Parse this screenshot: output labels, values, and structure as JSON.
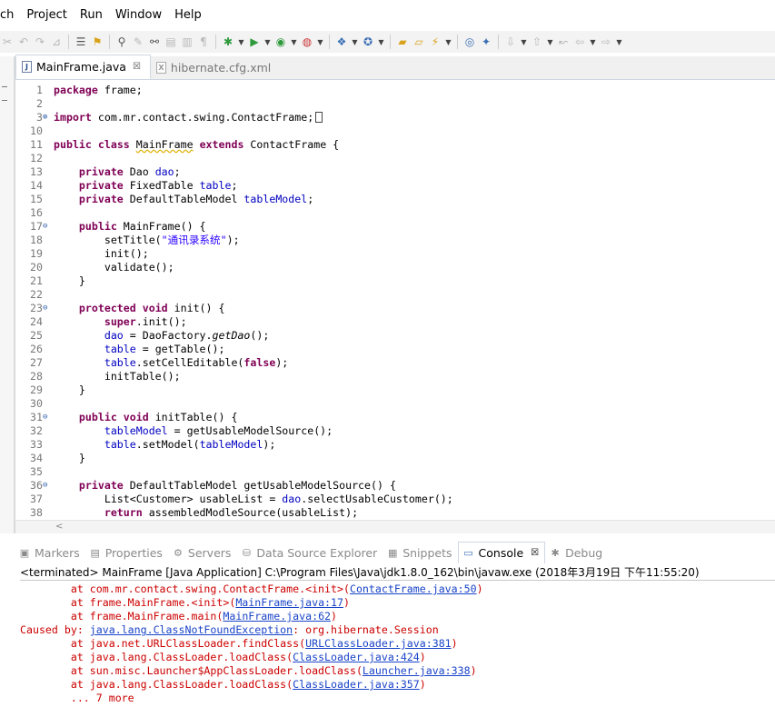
{
  "menu": [
    "ch",
    "Project",
    "Run",
    "Window",
    "Help"
  ],
  "editor": {
    "tabs": [
      {
        "label": "MainFrame.java",
        "active": true,
        "icon": "java-file-icon"
      },
      {
        "label": "hibernate.cfg.xml",
        "active": false,
        "icon": "xml-file-icon"
      }
    ],
    "close_glyph": "☒"
  },
  "code_lines": [
    {
      "n": "1",
      "parts": [
        [
          "kw",
          "package"
        ],
        [
          "t",
          " frame;"
        ]
      ]
    },
    {
      "n": "2",
      "parts": []
    },
    {
      "n": "3",
      "fold": "plus",
      "parts": [
        [
          "kw",
          "import"
        ],
        [
          "t",
          " com.mr.contact.swing.ContactFrame;"
        ]
      ],
      "box": true
    },
    {
      "n": "10",
      "parts": []
    },
    {
      "n": "11",
      "glyph": "warning",
      "parts": [
        [
          "kw",
          "public"
        ],
        [
          "t",
          " "
        ],
        [
          "kw",
          "class"
        ],
        [
          "t",
          " "
        ],
        [
          "u",
          "MainFrame"
        ],
        [
          "t",
          " "
        ],
        [
          "kw",
          "extends"
        ],
        [
          "t",
          " ContactFrame {"
        ]
      ]
    },
    {
      "n": "12",
      "parts": []
    },
    {
      "n": "13",
      "parts": [
        [
          "t",
          "    "
        ],
        [
          "kw",
          "private"
        ],
        [
          "t",
          " Dao "
        ],
        [
          "fd",
          "dao"
        ],
        [
          "t",
          ";"
        ]
      ]
    },
    {
      "n": "14",
      "parts": [
        [
          "t",
          "    "
        ],
        [
          "kw",
          "private"
        ],
        [
          "t",
          " FixedTable "
        ],
        [
          "fd",
          "table"
        ],
        [
          "t",
          ";"
        ]
      ]
    },
    {
      "n": "15",
      "parts": [
        [
          "t",
          "    "
        ],
        [
          "kw",
          "private"
        ],
        [
          "t",
          " DefaultTableModel "
        ],
        [
          "fd",
          "tableModel"
        ],
        [
          "t",
          ";"
        ]
      ]
    },
    {
      "n": "16",
      "parts": []
    },
    {
      "n": "17",
      "fold": "minus",
      "parts": [
        [
          "t",
          "    "
        ],
        [
          "kw",
          "public"
        ],
        [
          "t",
          " MainFrame() {"
        ]
      ]
    },
    {
      "n": "18",
      "parts": [
        [
          "t",
          "        setTitle("
        ],
        [
          "st",
          "\"通讯录系统\""
        ],
        [
          "t",
          ");"
        ]
      ]
    },
    {
      "n": "19",
      "parts": [
        [
          "t",
          "        init();"
        ]
      ]
    },
    {
      "n": "20",
      "parts": [
        [
          "t",
          "        validate();"
        ]
      ]
    },
    {
      "n": "21",
      "parts": [
        [
          "t",
          "    }"
        ]
      ]
    },
    {
      "n": "22",
      "parts": []
    },
    {
      "n": "23",
      "fold": "minus",
      "glyph": "override",
      "parts": [
        [
          "t",
          "    "
        ],
        [
          "kw",
          "protected"
        ],
        [
          "t",
          " "
        ],
        [
          "kw",
          "void"
        ],
        [
          "t",
          " init() {"
        ]
      ]
    },
    {
      "n": "24",
      "parts": [
        [
          "t",
          "        "
        ],
        [
          "kw",
          "super"
        ],
        [
          "t",
          ".init();"
        ]
      ]
    },
    {
      "n": "25",
      "parts": [
        [
          "t",
          "        "
        ],
        [
          "fd",
          "dao"
        ],
        [
          "t",
          " = DaoFactory."
        ],
        [
          "it",
          "getDao"
        ],
        [
          "t",
          "();"
        ]
      ]
    },
    {
      "n": "26",
      "parts": [
        [
          "t",
          "        "
        ],
        [
          "fd",
          "table"
        ],
        [
          "t",
          " = getTable();"
        ]
      ]
    },
    {
      "n": "27",
      "parts": [
        [
          "t",
          "        "
        ],
        [
          "fd",
          "table"
        ],
        [
          "t",
          ".setCellEditable("
        ],
        [
          "kw",
          "false"
        ],
        [
          "t",
          ");"
        ]
      ]
    },
    {
      "n": "28",
      "parts": [
        [
          "t",
          "        initTable();"
        ]
      ]
    },
    {
      "n": "29",
      "parts": [
        [
          "t",
          "    }"
        ]
      ]
    },
    {
      "n": "30",
      "parts": []
    },
    {
      "n": "31",
      "fold": "minus",
      "parts": [
        [
          "t",
          "    "
        ],
        [
          "kw",
          "public"
        ],
        [
          "t",
          " "
        ],
        [
          "kw",
          "void"
        ],
        [
          "t",
          " initTable() {"
        ]
      ]
    },
    {
      "n": "32",
      "parts": [
        [
          "t",
          "        "
        ],
        [
          "fd",
          "tableModel"
        ],
        [
          "t",
          " = getUsableModelSource();"
        ]
      ]
    },
    {
      "n": "33",
      "parts": [
        [
          "t",
          "        "
        ],
        [
          "fd",
          "table"
        ],
        [
          "t",
          ".setModel("
        ],
        [
          "fd",
          "tableModel"
        ],
        [
          "t",
          ");"
        ]
      ]
    },
    {
      "n": "34",
      "parts": [
        [
          "t",
          "    }"
        ]
      ]
    },
    {
      "n": "35",
      "parts": []
    },
    {
      "n": "36",
      "fold": "minus",
      "parts": [
        [
          "t",
          "    "
        ],
        [
          "kw",
          "private"
        ],
        [
          "t",
          " DefaultTableModel getUsableModelSource() {"
        ]
      ]
    },
    {
      "n": "37",
      "parts": [
        [
          "t",
          "        List<Customer> usableList = "
        ],
        [
          "fd",
          "dao"
        ],
        [
          "t",
          ".selectUsableCustomer();"
        ]
      ]
    },
    {
      "n": "38",
      "parts": [
        [
          "t",
          "        "
        ],
        [
          "kw",
          "return"
        ],
        [
          "t",
          " assembledModleSource(usableList);"
        ]
      ]
    }
  ],
  "scroll_glyph": "<",
  "panel": {
    "tabs": [
      {
        "label": "Markers",
        "icon": "markers-icon",
        "active": false
      },
      {
        "label": "Properties",
        "icon": "properties-icon",
        "active": false
      },
      {
        "label": "Servers",
        "icon": "servers-icon",
        "active": false
      },
      {
        "label": "Data Source Explorer",
        "icon": "data-source-icon",
        "active": false
      },
      {
        "label": "Snippets",
        "icon": "snippets-icon",
        "active": false
      },
      {
        "label": "Console",
        "icon": "console-icon",
        "active": true
      },
      {
        "label": "Debug",
        "icon": "debug-icon",
        "active": false
      }
    ],
    "status": "<terminated> MainFrame [Java Application] C:\\Program Files\\Java\\jdk1.8.0_162\\bin\\javaw.exe (2018年3月19日 下午11:55:20)"
  },
  "console_lines": [
    [
      [
        "t",
        "        at com.mr.contact.swing.ContactFrame.<init>("
      ],
      [
        "l",
        "ContactFrame.java:50"
      ],
      [
        "t",
        ")"
      ]
    ],
    [
      [
        "t",
        "        at frame.MainFrame.<init>("
      ],
      [
        "l",
        "MainFrame.java:17"
      ],
      [
        "t",
        ")"
      ]
    ],
    [
      [
        "t",
        "        at frame.MainFrame.main("
      ],
      [
        "l",
        "MainFrame.java:62"
      ],
      [
        "t",
        ")"
      ]
    ],
    [
      [
        "t",
        "Caused by: "
      ],
      [
        "l",
        "java.lang.ClassNotFoundException"
      ],
      [
        "t",
        ": org.hibernate.Session"
      ]
    ],
    [
      [
        "t",
        "        at java.net.URLClassLoader.findClass("
      ],
      [
        "l",
        "URLClassLoader.java:381"
      ],
      [
        "t",
        ")"
      ]
    ],
    [
      [
        "t",
        "        at java.lang.ClassLoader.loadClass("
      ],
      [
        "l",
        "ClassLoader.java:424"
      ],
      [
        "t",
        ")"
      ]
    ],
    [
      [
        "t",
        "        at sun.misc.Launcher$AppClassLoader.loadClass("
      ],
      [
        "l",
        "Launcher.java:338"
      ],
      [
        "t",
        ")"
      ]
    ],
    [
      [
        "t",
        "        at java.lang.ClassLoader.loadClass("
      ],
      [
        "l",
        "ClassLoader.java:357"
      ],
      [
        "t",
        ")"
      ]
    ],
    [
      [
        "t",
        "        ... 7 more"
      ]
    ]
  ],
  "colors": {
    "keyword": "#7f0055",
    "field": "#0000c0",
    "string": "#2a00ff",
    "error": "#cc0000",
    "link": "#1a44c8"
  }
}
